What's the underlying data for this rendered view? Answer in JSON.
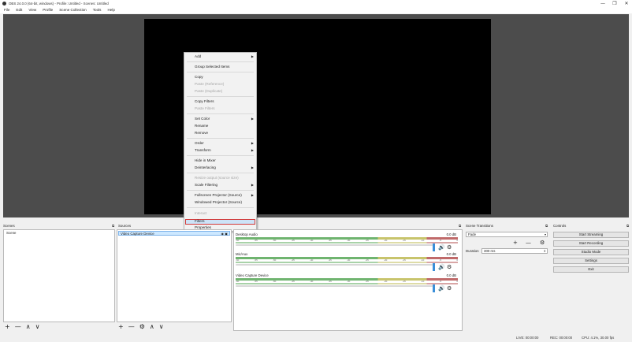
{
  "window": {
    "title": "OBS 24.0.0 (64-bit, windows) - Profile: Untitled - Scenes: Untitled",
    "controls": [
      "—",
      "❐",
      "✕"
    ]
  },
  "menubar": [
    "File",
    "Edit",
    "View",
    "Profile",
    "Scene Collection",
    "Tools",
    "Help"
  ],
  "context_menu": [
    {
      "label": "Add",
      "submenu": true,
      "disabled": false
    },
    {
      "label": "Group Selected Items",
      "submenu": false,
      "disabled": false
    },
    {
      "label": "Copy",
      "submenu": false,
      "disabled": false
    },
    {
      "label": "Paste (Reference)",
      "submenu": false,
      "disabled": true
    },
    {
      "label": "Paste (Duplicate)",
      "submenu": false,
      "disabled": true
    },
    {
      "label": "Copy Filters",
      "submenu": false,
      "disabled": false
    },
    {
      "label": "Paste Filters",
      "submenu": false,
      "disabled": true
    },
    {
      "label": "Set Color",
      "submenu": true,
      "disabled": false
    },
    {
      "label": "Rename",
      "submenu": false,
      "disabled": false
    },
    {
      "label": "Remove",
      "submenu": false,
      "disabled": false
    },
    {
      "label": "Order",
      "submenu": true,
      "disabled": false
    },
    {
      "label": "Transform",
      "submenu": true,
      "disabled": false
    },
    {
      "label": "Hide in Mixer",
      "submenu": false,
      "disabled": false
    },
    {
      "label": "Deinterlacing",
      "submenu": true,
      "disabled": false
    },
    {
      "label": "Resize output (source size)",
      "submenu": false,
      "disabled": true
    },
    {
      "label": "Scale Filtering",
      "submenu": true,
      "disabled": false
    },
    {
      "label": "Fullscreen Projector (Source)",
      "submenu": true,
      "disabled": false
    },
    {
      "label": "Windowed Projector (Source)",
      "submenu": false,
      "disabled": false
    },
    {
      "label": "Interact",
      "submenu": false,
      "disabled": true
    },
    {
      "label": "Filters",
      "submenu": false,
      "disabled": false,
      "highlighted": true
    },
    {
      "label": "Properties",
      "submenu": false,
      "disabled": false
    }
  ],
  "docks": {
    "scenes": {
      "title": "Scenes",
      "items": [
        "Scene"
      ]
    },
    "sources": {
      "title": "Sources",
      "items": [
        "Video Capture Device"
      ]
    },
    "mixer": {
      "title": "Audio Mixer",
      "channels": [
        {
          "name": "Desktop Audio",
          "db": "0.0 dB"
        },
        {
          "name": "Mic/Aux",
          "db": "0.0 dB"
        },
        {
          "name": "Video Capture Device",
          "db": "0.0 dB"
        }
      ],
      "ticks": [
        "-60",
        "-55",
        "-50",
        "-45",
        "-40",
        "-35",
        "-30",
        "-25",
        "-20",
        "-15",
        "-10",
        "-5",
        "0"
      ]
    },
    "transitions": {
      "title": "Scene Transitions",
      "selected": "Fade",
      "duration_label": "Duration",
      "duration_value": "300 ms"
    },
    "controls": {
      "title": "Controls",
      "buttons": [
        "Start Streaming",
        "Start Recording",
        "Studio Mode",
        "Settings",
        "Exit"
      ]
    }
  },
  "toolbar_icons": {
    "scenes": [
      "+",
      "—",
      "∧",
      "∨"
    ],
    "sources": [
      "+",
      "—",
      "⚙",
      "∧",
      "∨"
    ]
  },
  "status": {
    "live": "LIVE: 00:00:00",
    "rec": "REC: 00:00:00",
    "cpu": "CPU: 4.1%, 30.00 fps"
  },
  "colors": {
    "highlight_border": "#d13a3a",
    "preview_bg": "#4c4c4c",
    "canvas": "#000000",
    "volume_handle": "#3b8fd9"
  }
}
